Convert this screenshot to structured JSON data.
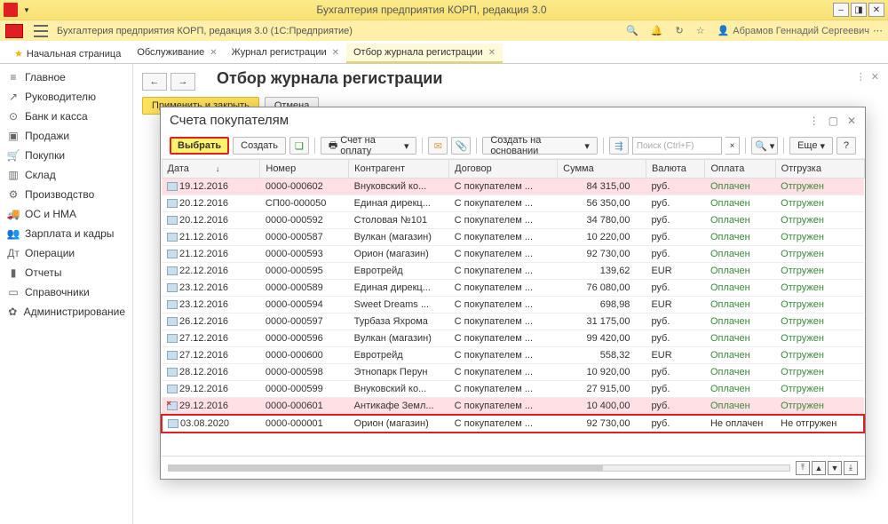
{
  "titlebar": {
    "title": "Бухгалтерия предприятия КОРП, редакция 3.0"
  },
  "modulebar": {
    "title": "Бухгалтерия предприятия КОРП, редакция 3.0  (1С:Предприятие)",
    "user": "Абрамов Геннадий Сергеевич"
  },
  "tabs": {
    "home": "Начальная страница",
    "items": [
      {
        "label": "Обслуживание"
      },
      {
        "label": "Журнал регистрации"
      },
      {
        "label": "Отбор журнала регистрации",
        "active": true
      }
    ]
  },
  "sidebar": {
    "items": [
      {
        "icon": "≡",
        "label": "Главное"
      },
      {
        "icon": "↗",
        "label": "Руководителю"
      },
      {
        "icon": "⊙",
        "label": "Банк и касса"
      },
      {
        "icon": "▣",
        "label": "Продажи"
      },
      {
        "icon": "🛒",
        "label": "Покупки"
      },
      {
        "icon": "▥",
        "label": "Склад"
      },
      {
        "icon": "⚙",
        "label": "Производство"
      },
      {
        "icon": "🚚",
        "label": "ОС и НМА"
      },
      {
        "icon": "👥",
        "label": "Зарплата и кадры"
      },
      {
        "icon": "Дт",
        "label": "Операции"
      },
      {
        "icon": "▮",
        "label": "Отчеты"
      },
      {
        "icon": "▭",
        "label": "Справочники"
      },
      {
        "icon": "✿",
        "label": "Администрирование"
      }
    ]
  },
  "panel": {
    "title": "Отбор журнала регистрации",
    "apply": "Применить и закрыть",
    "cancel": "Отмена"
  },
  "modal": {
    "title": "Счета покупателям",
    "select_btn": "Выбрать",
    "create_btn": "Создать",
    "bill_btn": "Счет на оплату",
    "create_based": "Создать на основании",
    "search_ph": "Поиск (Ctrl+F)",
    "more_btn": "Еще",
    "columns": {
      "date": "Дата",
      "number": "Номер",
      "counterparty": "Контрагент",
      "contract": "Договор",
      "sum": "Сумма",
      "currency": "Валюта",
      "payment": "Оплата",
      "shipment": "Отгрузка"
    },
    "rows": [
      {
        "date": "19.12.2016",
        "num": "0000-000602",
        "ka": "Внуковский ко...",
        "dog": "С покупателем ...",
        "sum": "84 315,00",
        "val": "руб.",
        "opl": "Оплачен",
        "otg": "Отгружен",
        "pink": true
      },
      {
        "date": "20.12.2016",
        "num": "СП00-000050",
        "ka": "Единая дирекц...",
        "dog": "С покупателем ...",
        "sum": "56 350,00",
        "val": "руб.",
        "opl": "Оплачен",
        "otg": "Отгружен"
      },
      {
        "date": "20.12.2016",
        "num": "0000-000592",
        "ka": "Столовая №101",
        "dog": "С покупателем ...",
        "sum": "34 780,00",
        "val": "руб.",
        "opl": "Оплачен",
        "otg": "Отгружен"
      },
      {
        "date": "21.12.2016",
        "num": "0000-000587",
        "ka": "Вулкан (магазин)",
        "dog": "С покупателем ...",
        "sum": "10 220,00",
        "val": "руб.",
        "opl": "Оплачен",
        "otg": "Отгружен"
      },
      {
        "date": "21.12.2016",
        "num": "0000-000593",
        "ka": "Орион (магазин)",
        "dog": "С покупателем ...",
        "sum": "92 730,00",
        "val": "руб.",
        "opl": "Оплачен",
        "otg": "Отгружен"
      },
      {
        "date": "22.12.2016",
        "num": "0000-000595",
        "ka": "Евротрейд",
        "dog": "С покупателем ...",
        "sum": "139,62",
        "val": "EUR",
        "opl": "Оплачен",
        "otg": "Отгружен"
      },
      {
        "date": "23.12.2016",
        "num": "0000-000589",
        "ka": "Единая дирекц...",
        "dog": "С покупателем ...",
        "sum": "76 080,00",
        "val": "руб.",
        "opl": "Оплачен",
        "otg": "Отгружен"
      },
      {
        "date": "23.12.2016",
        "num": "0000-000594",
        "ka": "Sweet Dreams ...",
        "dog": "С покупателем ...",
        "sum": "698,98",
        "val": "EUR",
        "opl": "Оплачен",
        "otg": "Отгружен"
      },
      {
        "date": "26.12.2016",
        "num": "0000-000597",
        "ka": "Турбаза Яхрома",
        "dog": "С покупателем ...",
        "sum": "31 175,00",
        "val": "руб.",
        "opl": "Оплачен",
        "otg": "Отгружен"
      },
      {
        "date": "27.12.2016",
        "num": "0000-000596",
        "ka": "Вулкан (магазин)",
        "dog": "С покупателем ...",
        "sum": "99 420,00",
        "val": "руб.",
        "opl": "Оплачен",
        "otg": "Отгружен"
      },
      {
        "date": "27.12.2016",
        "num": "0000-000600",
        "ka": "Евротрейд",
        "dog": "С покупателем ...",
        "sum": "558,32",
        "val": "EUR",
        "opl": "Оплачен",
        "otg": "Отгружен"
      },
      {
        "date": "28.12.2016",
        "num": "0000-000598",
        "ka": "Этнопарк Перун",
        "dog": "С покупателем ...",
        "sum": "10 920,00",
        "val": "руб.",
        "opl": "Оплачен",
        "otg": "Отгружен"
      },
      {
        "date": "29.12.2016",
        "num": "0000-000599",
        "ka": "Внуковский ко...",
        "dog": "С покупателем ...",
        "sum": "27 915,00",
        "val": "руб.",
        "opl": "Оплачен",
        "otg": "Отгружен"
      },
      {
        "date": "29.12.2016",
        "num": "0000-000601",
        "ka": "Антикафе Земл...",
        "dog": "С покупателем ...",
        "sum": "10 400,00",
        "val": "руб.",
        "opl": "Оплачен",
        "otg": "Отгружен",
        "pink": true,
        "deleted": true
      },
      {
        "date": "03.08.2020",
        "num": "0000-000001",
        "ka": "Орион (магазин)",
        "dog": "С покупателем ...",
        "sum": "92 730,00",
        "val": "руб.",
        "opl": "Не оплачен",
        "otg": "Не отгружен",
        "active": true
      }
    ]
  }
}
